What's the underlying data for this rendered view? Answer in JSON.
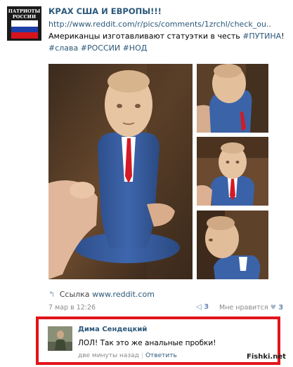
{
  "group": {
    "avatar_text_line1": "ПАТРИОТЫ",
    "avatar_text_line2": "РОССИИ",
    "title": "КРАХ США И ЕВРОПЫ!!!"
  },
  "post": {
    "url": "http://www.reddit.com/r/pics/comments/1zrchl/check_ou..",
    "text": "Американцы изготавливают статуэтки в честь",
    "hashtag1": "#ПУТИНА",
    "text_end": "!",
    "tags": "#слава #РОССИИ #НОД",
    "link_label": "Ссылка",
    "link_domain": "www.reddit.com",
    "date": "7 мар в 12:26",
    "reposts": "3",
    "like_label": "Мне нравится",
    "likes": "3"
  },
  "comment": {
    "author": "Дима Сендецкий",
    "text": "ЛОЛ! Так это же анальные пробки!",
    "time": "две минуты назад",
    "reply_label": "Ответить"
  },
  "watermark": "Fishki.net",
  "icons": {
    "share": "share-arrow-icon",
    "repost": "megaphone-icon",
    "heart": "heart-icon"
  }
}
